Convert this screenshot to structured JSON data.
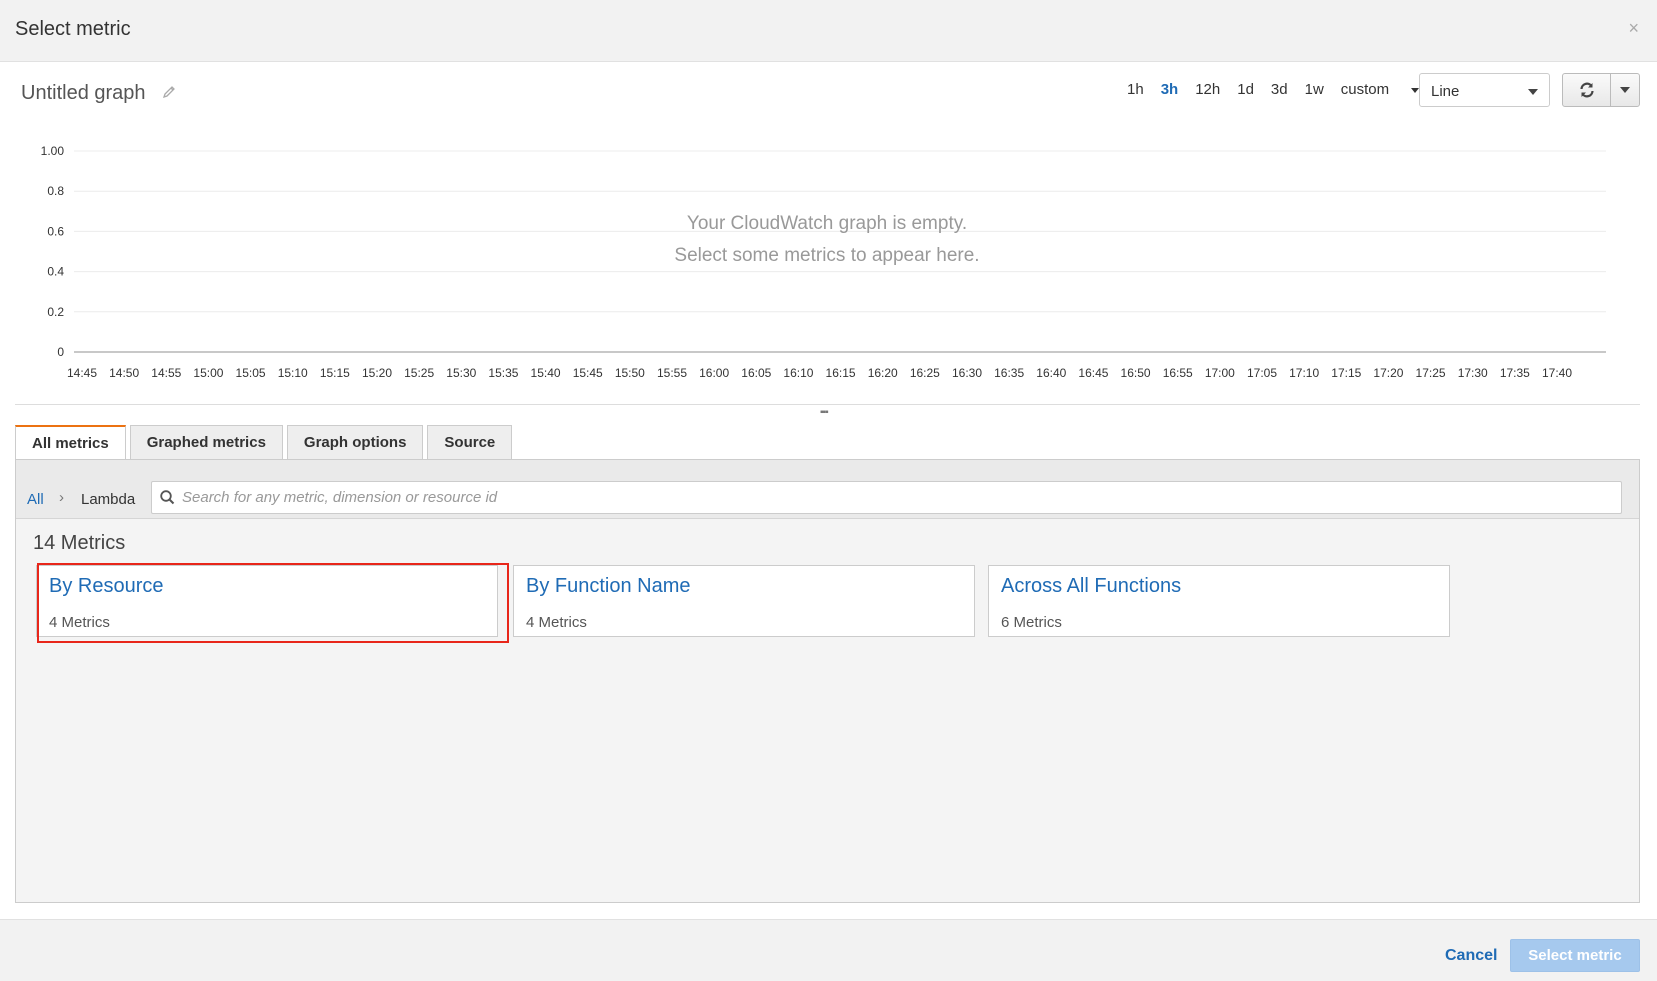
{
  "modal": {
    "title": "Select metric",
    "close_glyph": "×"
  },
  "graph": {
    "title": "Untitled graph",
    "time_ranges": [
      "1h",
      "3h",
      "12h",
      "1d",
      "3d",
      "1w"
    ],
    "active_range": "3h",
    "custom_label": "custom",
    "chart_type": "Line",
    "empty_line1": "Your CloudWatch graph is empty.",
    "empty_line2": "Select some metrics to appear here."
  },
  "chart_data": {
    "type": "line",
    "series": [],
    "y_ticks": [
      "1.00",
      "0.8",
      "0.6",
      "0.4",
      "0.2",
      "0"
    ],
    "x_ticks": [
      "14:45",
      "14:50",
      "14:55",
      "15:00",
      "15:05",
      "15:10",
      "15:15",
      "15:20",
      "15:25",
      "15:30",
      "15:35",
      "15:40",
      "15:45",
      "15:50",
      "15:55",
      "16:00",
      "16:05",
      "16:10",
      "16:15",
      "16:20",
      "16:25",
      "16:30",
      "16:35",
      "16:40",
      "16:45",
      "16:50",
      "16:55",
      "17:00",
      "17:05",
      "17:10",
      "17:15",
      "17:20",
      "17:25",
      "17:30",
      "17:35",
      "17:40"
    ],
    "ylim": [
      0,
      1
    ],
    "grid": true
  },
  "tabs": [
    "All metrics",
    "Graphed metrics",
    "Graph options",
    "Source"
  ],
  "browser": {
    "crumb_all": "All",
    "crumb_sep": "›",
    "crumb_current": "Lambda",
    "search_placeholder": "Search for any metric, dimension or resource id",
    "metrics_count": "14 Metrics",
    "cards": [
      {
        "title": "By Resource",
        "sub": "4 Metrics"
      },
      {
        "title": "By Function Name",
        "sub": "4 Metrics"
      },
      {
        "title": "Across All Functions",
        "sub": "6 Metrics"
      }
    ]
  },
  "footer": {
    "cancel": "Cancel",
    "select": "Select metric"
  },
  "colors": {
    "link": "#1f6bb5",
    "tab_accent": "#ec7211",
    "highlight": "#e8261a",
    "disabled_button": "#a6c9ee"
  }
}
